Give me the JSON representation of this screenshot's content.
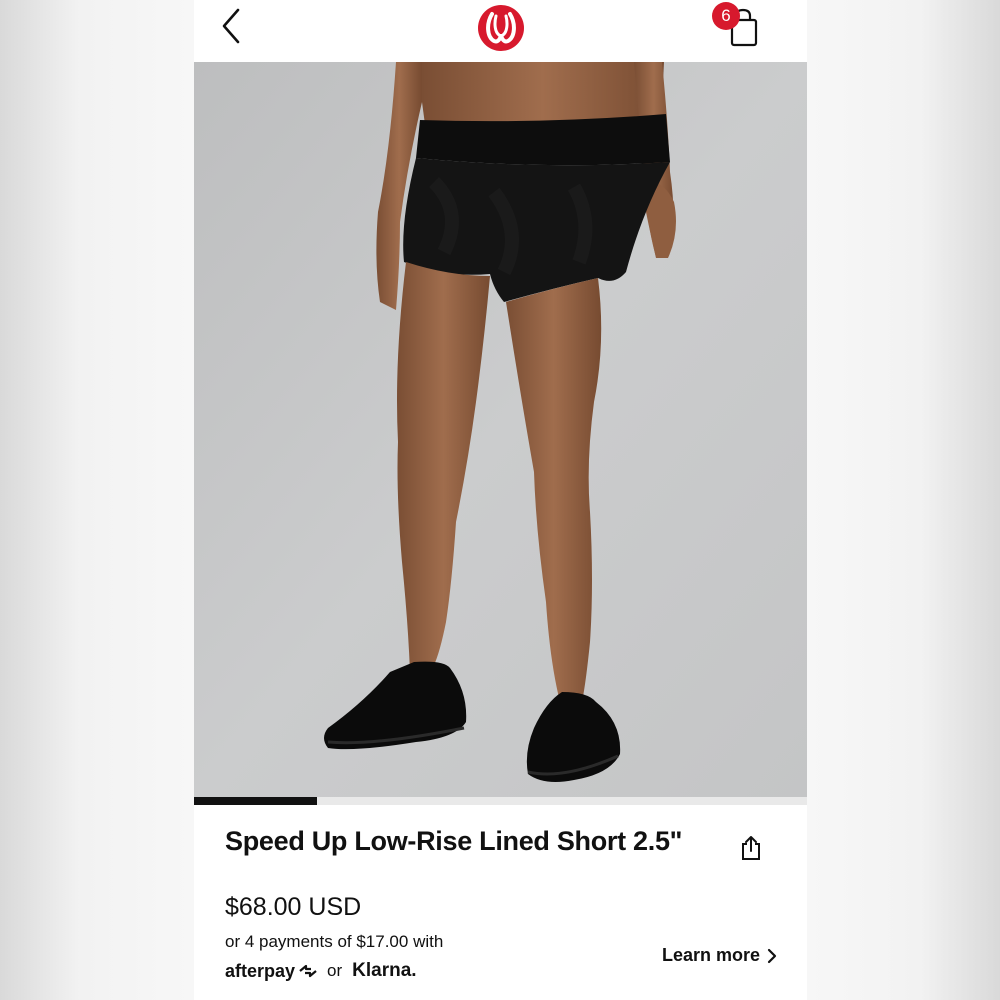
{
  "header": {
    "bag_count": "6"
  },
  "gallery": {
    "current_image": "1",
    "progress_fraction": 0.2
  },
  "product": {
    "title": "Speed Up Low-Rise Lined Short 2.5\"",
    "price": "$68.00 USD",
    "installments": "or 4 payments of $17.00 with",
    "afterpay_label": "afterpay",
    "or_label": "or",
    "klarna_label": "Klarna.",
    "learn_more_label": "Learn more"
  },
  "colors": {
    "brand_red": "#d7192d",
    "text": "#111111",
    "photo_background": "#c9cacb"
  },
  "icons": {
    "back": "chevron-left-icon",
    "logo": "lululemon-logo",
    "bag": "shopping-bag-icon",
    "share": "share-icon",
    "learn_more": "chevron-right-icon"
  }
}
